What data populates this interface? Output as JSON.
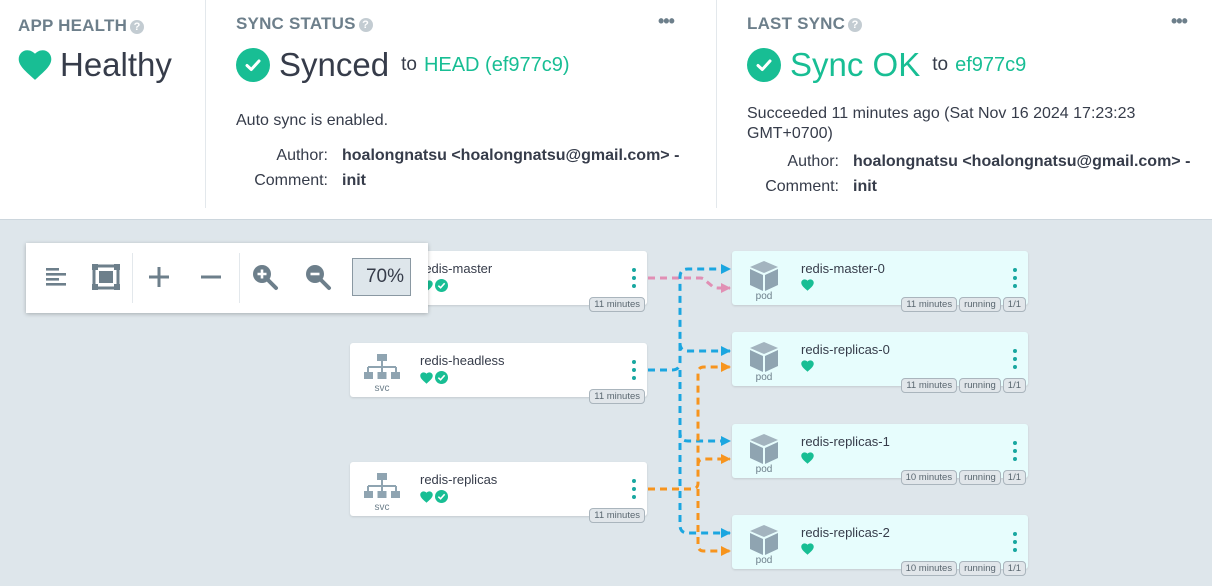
{
  "app_health": {
    "title": "APP HEALTH",
    "status": "Healthy",
    "help": "?"
  },
  "sync_status": {
    "title": "SYNC STATUS",
    "status": "Synced",
    "to_text": "to",
    "revision": "HEAD (ef977c9)",
    "help": "?",
    "menu": "•••",
    "message": "Auto sync is enabled.",
    "author_label": "Author:",
    "author": "hoalongnatsu <hoalongnatsu@gmail.com> -",
    "comment_label": "Comment:",
    "comment": "init"
  },
  "last_sync": {
    "title": "LAST SYNC",
    "status": "Sync OK",
    "to_text": "to",
    "revision": "ef977c9",
    "help": "?",
    "menu": "•••",
    "message_line1": "Succeeded 11 minutes ago (Sat Nov 16 2024 17:23:23",
    "message_line2": "GMT+0700)",
    "author_label": "Author:",
    "author": "hoalongnatsu <hoalongnatsu@gmail.com> -",
    "comment_label": "Comment:",
    "comment": "init"
  },
  "toolbar": {
    "zoom": "70%",
    "icons": [
      "align-left-icon",
      "fit-screen-icon",
      "plus-icon",
      "minus-icon",
      "zoom-in-icon",
      "zoom-out-icon"
    ]
  },
  "nodes": {
    "redis_master": {
      "name": "redis-master",
      "age": "11 minutes"
    },
    "redis_headless": {
      "name": "redis-headless",
      "kind": "svc",
      "age": "11 minutes"
    },
    "redis_replicas": {
      "name": "redis-replicas",
      "kind": "svc",
      "age": "11 minutes"
    },
    "pod_master_0": {
      "name": "redis-master-0",
      "kind": "pod",
      "age": "11 minutes",
      "state": "running",
      "ready": "1/1"
    },
    "pod_replicas_0": {
      "name": "redis-replicas-0",
      "kind": "pod",
      "age": "11 minutes",
      "state": "running",
      "ready": "1/1"
    },
    "pod_replicas_1": {
      "name": "redis-replicas-1",
      "kind": "pod",
      "age": "10 minutes",
      "state": "running",
      "ready": "1/1"
    },
    "pod_replicas_2": {
      "name": "redis-replicas-2",
      "kind": "pod",
      "age": "10 minutes",
      "state": "running",
      "ready": "1/1"
    }
  },
  "colors": {
    "accent_green": "#18be94",
    "edge_blue": "#1ba6e0",
    "edge_orange": "#f7941d",
    "edge_pink": "#e18fb4",
    "pod_background": "#e7fdfd",
    "graph_background": "#dee6eb"
  }
}
